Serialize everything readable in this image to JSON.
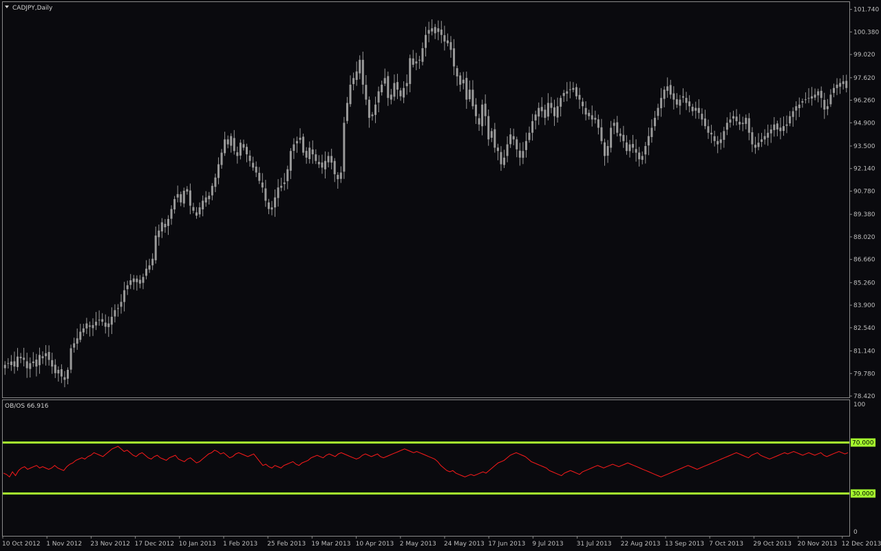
{
  "window": {
    "title": "CADJPY,Daily",
    "indicator_label": "OB/OS 66.916"
  },
  "colors": {
    "background": "#0a0a0e",
    "frame": "#8a8a8a",
    "candle": "#9a9a9a",
    "oscillator": "#ff1a1a",
    "levels": "#a6ff2e",
    "tick_text": "#bfbfbf"
  },
  "chart_data": [
    {
      "type": "candlestick",
      "title": "CADJPY,Daily",
      "ylim": [
        78.42,
        102.1
      ],
      "yticks": [
        "101.740",
        "100.380",
        "99.020",
        "97.620",
        "96.260",
        "94.900",
        "93.500",
        "92.140",
        "90.780",
        "89.380",
        "88.020",
        "86.660",
        "85.260",
        "83.900",
        "82.540",
        "81.140",
        "79.780",
        "78.420"
      ],
      "xticks": [
        "10 Oct 2012",
        "1 Nov 2012",
        "23 Nov 2012",
        "17 Dec 2012",
        "10 Jan 2013",
        "1 Feb 2013",
        "25 Feb 2013",
        "19 Mar 2013",
        "10 Apr 2013",
        "2 May 2013",
        "24 May 2013",
        "17 Jun 2013",
        "9 Jul 2013",
        "31 Jul 2013",
        "22 Aug 2013",
        "13 Sep 2013",
        "7 Oct 2013",
        "29 Oct 2013",
        "20 Nov 2013",
        "12 Dec 2013"
      ],
      "close_series": [
        80.3,
        80.4,
        80.5,
        80.2,
        80.8,
        80.7,
        80.6,
        80.1,
        80.4,
        80.5,
        80.2,
        80.9,
        80.7,
        81.0,
        80.6,
        80.2,
        79.8,
        80.0,
        79.6,
        79.4,
        80.0,
        81.3,
        81.6,
        81.9,
        82.3,
        82.5,
        82.8,
        82.6,
        82.7,
        82.9,
        83.0,
        82.9,
        82.6,
        82.8,
        83.2,
        83.6,
        83.7,
        84.1,
        84.8,
        85.1,
        85.4,
        85.3,
        85.5,
        85.2,
        85.6,
        86.1,
        86.3,
        86.7,
        88.1,
        88.4,
        88.9,
        88.6,
        89.1,
        89.7,
        90.3,
        90.6,
        90.1,
        90.8,
        90.9,
        89.9,
        89.6,
        89.3,
        89.8,
        90.2,
        90.4,
        90.5,
        91.1,
        91.6,
        92.4,
        93.1,
        93.9,
        93.6,
        94.1,
        93.2,
        92.9,
        93.7,
        93.4,
        93.0,
        92.6,
        92.2,
        91.9,
        91.4,
        91.0,
        90.2,
        89.7,
        89.8,
        90.4,
        91.0,
        91.1,
        91.3,
        92.1,
        93.2,
        93.6,
        93.8,
        94.0,
        93.1,
        92.8,
        93.4,
        93.0,
        92.6,
        92.4,
        92.2,
        92.6,
        92.9,
        92.5,
        91.8,
        91.5,
        91.9,
        94.9,
        96.1,
        97.2,
        97.6,
        98.0,
        98.7,
        97.2,
        96.3,
        95.2,
        95.4,
        96.0,
        96.8,
        97.2,
        97.6,
        96.4,
        96.6,
        97.3,
        96.9,
        96.5,
        97.0,
        97.3,
        98.8,
        98.4,
        98.6,
        98.7,
        99.4,
        100.2,
        100.5,
        100.6,
        100.3,
        100.6,
        100.2,
        99.8,
        99.7,
        99.3,
        98.3,
        97.7,
        97.2,
        97.5,
        96.3,
        96.9,
        95.9,
        95.3,
        94.8,
        96.0,
        95.3,
        93.9,
        94.4,
        93.4,
        93.2,
        92.4,
        92.8,
        93.6,
        94.2,
        93.9,
        93.3,
        92.8,
        93.2,
        93.8,
        94.3,
        95.0,
        95.4,
        95.8,
        95.6,
        95.2,
        96.1,
        95.8,
        95.3,
        95.9,
        96.4,
        96.7,
        96.8,
        96.9,
        97.0,
        96.5,
        96.3,
        95.9,
        95.4,
        95.3,
        95.1,
        95.2,
        94.6,
        93.8,
        92.9,
        93.5,
        94.6,
        94.9,
        94.3,
        94.1,
        93.8,
        93.2,
        93.6,
        93.4,
        93.1,
        92.7,
        92.9,
        93.5,
        94.1,
        94.6,
        95.2,
        95.8,
        96.4,
        96.9,
        97.1,
        96.6,
        96.3,
        96.0,
        96.3,
        96.5,
        96.1,
        95.9,
        95.6,
        95.8,
        95.5,
        95.1,
        94.7,
        94.3,
        94.2,
        93.8,
        93.6,
        93.9,
        94.4,
        94.9,
        95.1,
        95.3,
        95.0,
        94.8,
        94.9,
        95.2,
        94.3,
        93.6,
        93.4,
        93.7,
        93.9,
        94.1,
        94.3,
        94.5,
        94.8,
        94.5,
        94.4,
        94.7,
        94.8,
        95.3,
        95.6,
        95.9,
        96.0,
        96.2,
        96.3,
        96.4,
        96.5,
        96.6,
        96.8,
        96.4,
        95.7,
        95.9,
        96.6,
        97.0,
        97.2,
        97.3,
        97.4,
        97.0
      ]
    },
    {
      "type": "line",
      "title": "OB/OS 66.916",
      "ylim": [
        0,
        100
      ],
      "yticks": [
        "100",
        "0"
      ],
      "levels": [
        {
          "label": "70.000",
          "value": 70
        },
        {
          "label": "30.000",
          "value": 30
        }
      ],
      "values": [
        46,
        45,
        43,
        47,
        44,
        48,
        50,
        51,
        49,
        50,
        51,
        52,
        50,
        51,
        50,
        49,
        50,
        52,
        50,
        49,
        48,
        51,
        53,
        54,
        56,
        57,
        58,
        57,
        59,
        60,
        62,
        61,
        60,
        59,
        61,
        63,
        65,
        66,
        67,
        65,
        63,
        64,
        62,
        60,
        59,
        61,
        62,
        60,
        58,
        57,
        59,
        60,
        58,
        57,
        56,
        58,
        59,
        60,
        57,
        56,
        55,
        57,
        58,
        56,
        54,
        55,
        57,
        59,
        61,
        62,
        64,
        63,
        61,
        62,
        60,
        58,
        59,
        61,
        62,
        61,
        60,
        59,
        60,
        61,
        58,
        55,
        52,
        53,
        51,
        50,
        52,
        51,
        50,
        52,
        53,
        54,
        55,
        53,
        52,
        54,
        55,
        56,
        58,
        59,
        60,
        59,
        58,
        60,
        61,
        60,
        59,
        61,
        62,
        61,
        60,
        59,
        58,
        57,
        58,
        60,
        61,
        60,
        59,
        60,
        61,
        59,
        58,
        59,
        60,
        61,
        62,
        63,
        64,
        65,
        64,
        63,
        62,
        63,
        62,
        61,
        60,
        59,
        58,
        57,
        55,
        52,
        50,
        48,
        47,
        48,
        46,
        45,
        44,
        43,
        44,
        45,
        44,
        45,
        46,
        47,
        46,
        48,
        50,
        52,
        54,
        55,
        56,
        58,
        60,
        61,
        62,
        61,
        60,
        59,
        57,
        55,
        54,
        53,
        52,
        51,
        50,
        48,
        47,
        46,
        45,
        44,
        46,
        47,
        48,
        47,
        46,
        45,
        47,
        48,
        49,
        50,
        51,
        52,
        51,
        50,
        51,
        52,
        53,
        52,
        51,
        52,
        53,
        54,
        53,
        52,
        51,
        50,
        49,
        48,
        47,
        46,
        45,
        44,
        43,
        44,
        45,
        46,
        47,
        48,
        49,
        50,
        51,
        52,
        51,
        50,
        49,
        50,
        51,
        52,
        53,
        54,
        55,
        56,
        57,
        58,
        59,
        60,
        61,
        62,
        61,
        60,
        59,
        58,
        60,
        61,
        62,
        60,
        59,
        58,
        57,
        58,
        59,
        60,
        61,
        62,
        61,
        62,
        63,
        62,
        61,
        60,
        61,
        62,
        61,
        60,
        61,
        62,
        60,
        59,
        60,
        61,
        62,
        63,
        62,
        61,
        62
      ]
    }
  ]
}
